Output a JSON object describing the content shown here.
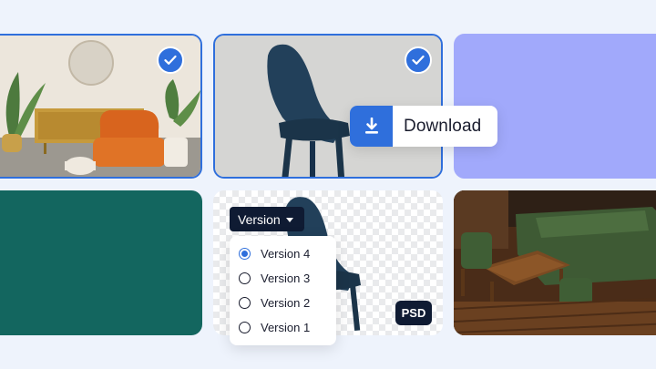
{
  "tiles": [
    {
      "name": "living-room-photo",
      "selected": true
    },
    {
      "name": "blue-chair-photo",
      "selected": true
    },
    {
      "name": "color-swatch",
      "color": "#a1a9fb"
    },
    {
      "name": "color-swatch",
      "color": "#13665f"
    },
    {
      "name": "chair-psd-file"
    },
    {
      "name": "green-sofa-room-photo"
    }
  ],
  "download": {
    "label": "Download",
    "icon": "download-icon"
  },
  "version_select": {
    "label": "Version",
    "options": [
      "Version 4",
      "Version 3",
      "Version 2",
      "Version 1"
    ],
    "selected": "Version 4"
  },
  "badge": {
    "label": "PSD"
  },
  "colors": {
    "accent": "#2f6fdc",
    "dark": "#0f1b33"
  }
}
